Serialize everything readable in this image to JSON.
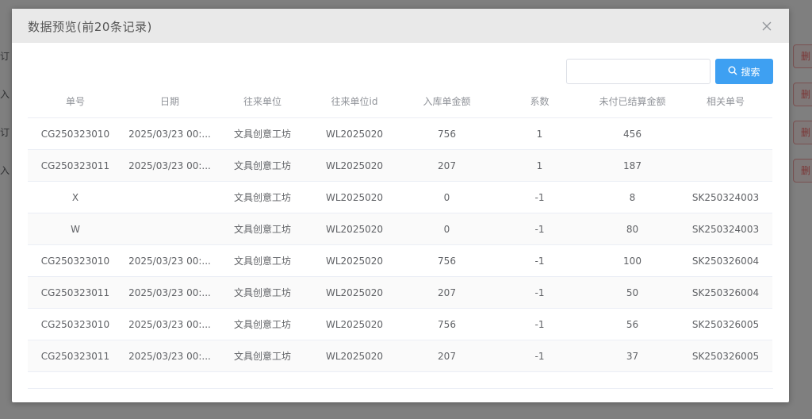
{
  "background": {
    "side_labels": [
      "订",
      "入",
      "订",
      "入"
    ],
    "row_buttons": [
      "删",
      "删",
      "删",
      "删"
    ]
  },
  "dialog": {
    "title": "数据预览(前20条记录)",
    "close_icon": "close-icon",
    "search": {
      "value": "",
      "placeholder": "",
      "button_label": "搜索",
      "button_icon": "search-icon"
    },
    "table": {
      "columns": [
        "单号",
        "日期",
        "往来单位",
        "往来单位id",
        "入库单金额",
        "系数",
        "未付已结算金额",
        "相关单号"
      ],
      "rows": [
        [
          "CG250323010",
          "2025/03/23 00:...",
          "文具创意工坊",
          "WL2025020",
          "756",
          "1",
          "456",
          ""
        ],
        [
          "CG250323011",
          "2025/03/23 00:...",
          "文具创意工坊",
          "WL2025020",
          "207",
          "1",
          "187",
          ""
        ],
        [
          "X",
          "",
          "文具创意工坊",
          "WL2025020",
          "0",
          "-1",
          "8",
          "SK250324003"
        ],
        [
          "W",
          "",
          "文具创意工坊",
          "WL2025020",
          "0",
          "-1",
          "80",
          "SK250324003"
        ],
        [
          "CG250323010",
          "2025/03/23 00:...",
          "文具创意工坊",
          "WL2025020",
          "756",
          "-1",
          "100",
          "SK250326004"
        ],
        [
          "CG250323011",
          "2025/03/23 00:...",
          "文具创意工坊",
          "WL2025020",
          "207",
          "-1",
          "50",
          "SK250326004"
        ],
        [
          "CG250323010",
          "2025/03/23 00:...",
          "文具创意工坊",
          "WL2025020",
          "756",
          "-1",
          "56",
          "SK250326005"
        ],
        [
          "CG250323011",
          "2025/03/23 00:...",
          "文具创意工坊",
          "WL2025020",
          "207",
          "-1",
          "37",
          "SK250326005"
        ]
      ]
    }
  },
  "colors": {
    "primary": "#3ea0f2",
    "header_bg": "#e9e9e9",
    "danger": "#f56c6c"
  }
}
